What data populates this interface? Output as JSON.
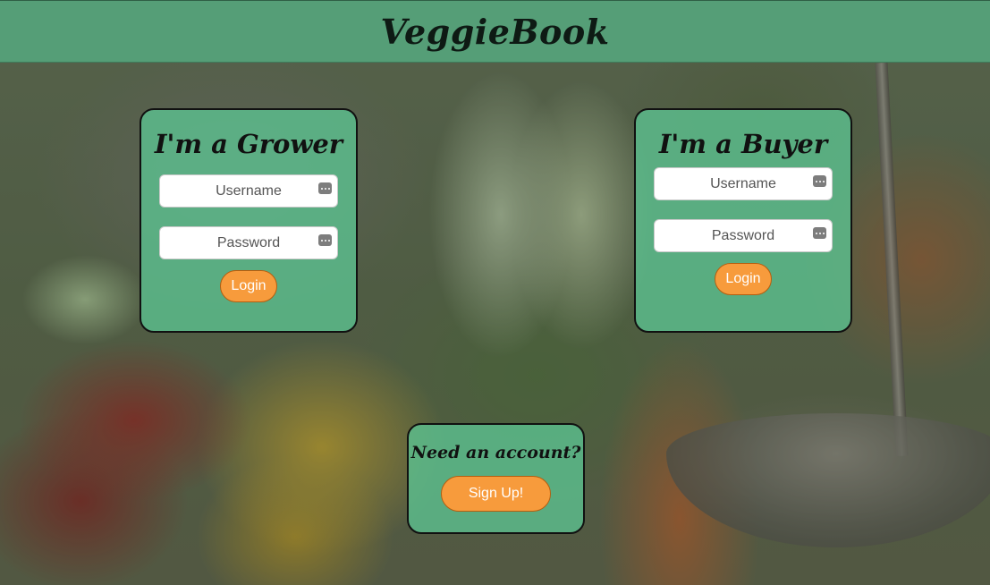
{
  "header": {
    "title": "VeggieBook"
  },
  "grower": {
    "heading": "I'm a Grower",
    "username_placeholder": "Username",
    "password_placeholder": "Password",
    "login_label": "Login"
  },
  "buyer": {
    "heading": "I'm a Buyer",
    "username_placeholder": "Username",
    "password_placeholder": "Password",
    "login_label": "Login"
  },
  "signup": {
    "prompt": "Need an account?",
    "button_label": "Sign Up!"
  },
  "colors": {
    "header_bg": "#559e77",
    "card_bg": "#5cc492",
    "button_bg": "#f79b3c"
  },
  "icons": {
    "field_autofill": "password-manager-icon"
  }
}
